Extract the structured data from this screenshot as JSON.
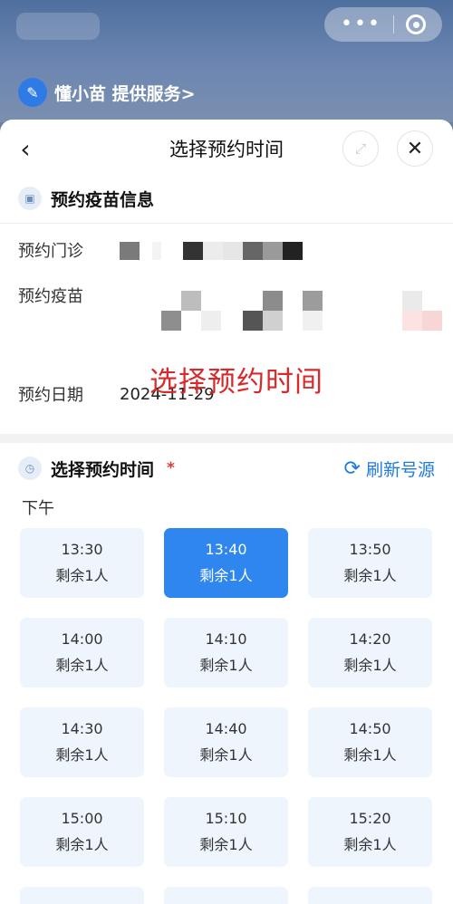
{
  "background": {
    "provider_label": "懂小苗 提供服务>",
    "capsule": {
      "more_icon": "more-dots-icon",
      "close_icon": "target-icon"
    }
  },
  "sheet": {
    "title": "选择预约时间",
    "back_icon": "chevron-left-icon",
    "expand_icon": "expand-icon",
    "close_icon": "close-icon"
  },
  "info": {
    "section_title": "预约疫苗信息",
    "clinic_label": "预约门诊",
    "vaccine_label": "预约疫苗",
    "date_label": "预约日期",
    "date_value": "2024-11-29"
  },
  "time": {
    "section_title": "选择预约时间",
    "required_mark": "*",
    "refresh_label": "刷新号源",
    "annotation": "选择预约时间",
    "period": "下午",
    "slots": [
      {
        "time": "13:30",
        "remain": "剩余1人",
        "selected": false
      },
      {
        "time": "13:40",
        "remain": "剩余1人",
        "selected": true
      },
      {
        "time": "13:50",
        "remain": "剩余1人",
        "selected": false
      },
      {
        "time": "14:00",
        "remain": "剩余1人",
        "selected": false
      },
      {
        "time": "14:10",
        "remain": "剩余1人",
        "selected": false
      },
      {
        "time": "14:20",
        "remain": "剩余1人",
        "selected": false
      },
      {
        "time": "14:30",
        "remain": "剩余1人",
        "selected": false
      },
      {
        "time": "14:40",
        "remain": "剩余1人",
        "selected": false
      },
      {
        "time": "14:50",
        "remain": "剩余1人",
        "selected": false
      },
      {
        "time": "15:00",
        "remain": "剩余1人",
        "selected": false
      },
      {
        "time": "15:10",
        "remain": "剩余1人",
        "selected": false
      },
      {
        "time": "15:20",
        "remain": "剩余1人",
        "selected": false
      }
    ]
  },
  "colors": {
    "accent": "#2e86ee",
    "slot_bg": "#eef5fd",
    "required": "#e23838",
    "annotation": "#d82a2a",
    "link": "#1f7ae0"
  }
}
